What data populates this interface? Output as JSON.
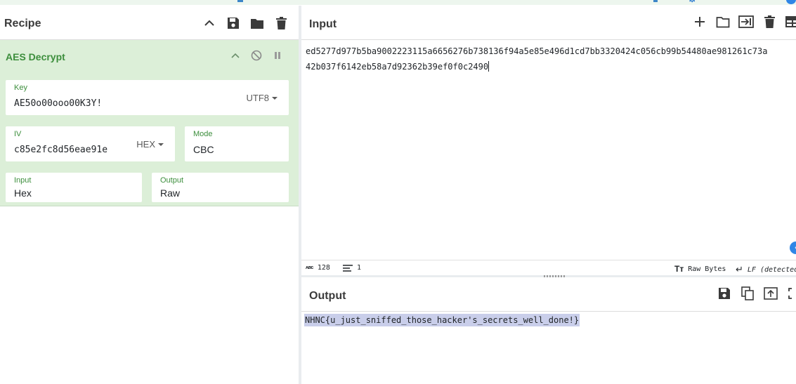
{
  "recipe": {
    "title": "Recipe",
    "operation": {
      "name": "AES Decrypt",
      "key": {
        "label": "Key",
        "value": "AE50o00ooo00K3Y!",
        "encoding": "UTF8"
      },
      "iv": {
        "label": "IV",
        "value": "c85e2fc8d56eae91e",
        "encoding": "HEX"
      },
      "mode": {
        "label": "Mode",
        "value": "CBC"
      },
      "input_format": {
        "label": "Input",
        "value": "Hex"
      },
      "output_format": {
        "label": "Output",
        "value": "Raw"
      }
    }
  },
  "input": {
    "title": "Input",
    "lines": [
      "ed5277d977b5ba9002223115a6656276b738136f94a5e85e496d1cd7bb3320424c056cb99b54480ae981261c73a",
      "42b037f6142eb58a7d92362b39ef0f0c2490"
    ],
    "status": {
      "length": "128",
      "lines": "1",
      "encoding": "Raw Bytes",
      "eol": "LF (detected)"
    }
  },
  "output": {
    "title": "Output",
    "text": "NHNC{u_just_sniffed_those_hacker's_secrets_well_done!}"
  },
  "colors": {
    "accent": "#3c8e3c",
    "op_bg": "#dcefd8",
    "selection": "#c9ceea",
    "blue": "#2f86e6"
  }
}
